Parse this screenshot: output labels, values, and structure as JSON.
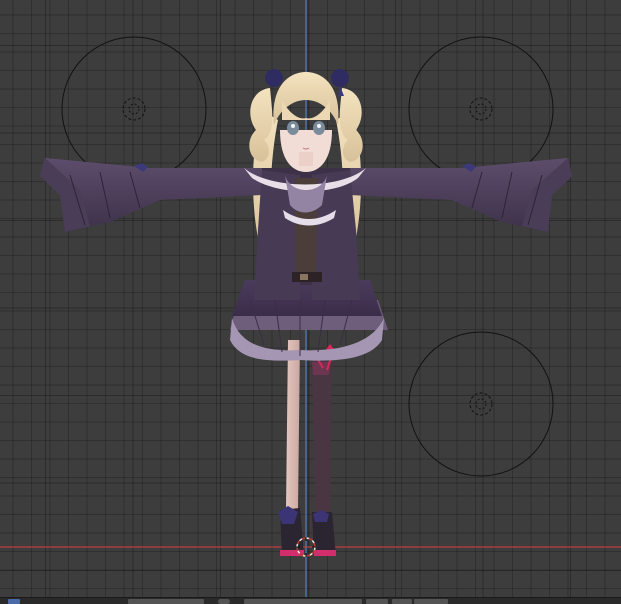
{
  "viewport": {
    "type": "3d-viewport",
    "view": "front-orthographic",
    "axis_colors": {
      "x": "#b84040",
      "z": "#4f7fd0"
    },
    "grid_color": "#3d3d3d"
  },
  "scene": {
    "model": "anime-girl-character",
    "pose": "t-pose",
    "control_rings": [
      "ring-upper-left",
      "ring-upper-right",
      "ring-lower-right"
    ],
    "origin_cursor": "3d-cursor-icon"
  },
  "header": {
    "widgets": [
      "view-toggle",
      "search-field",
      "orientation-icon",
      "mode-dropdown",
      "overlay-button",
      "shading-button",
      "more-button"
    ]
  }
}
